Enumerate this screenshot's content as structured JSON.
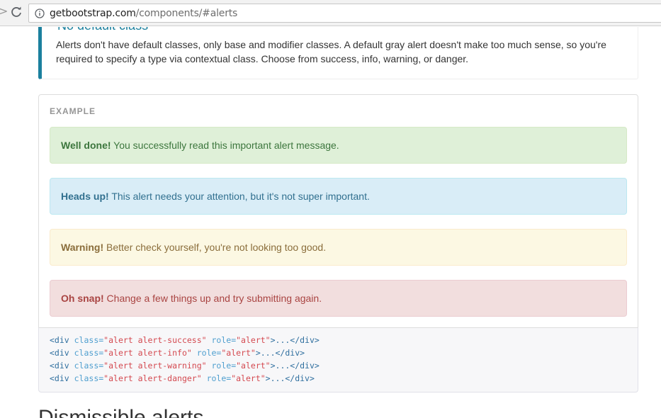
{
  "browser": {
    "url_host": "getbootstrap.com",
    "url_path": "/components/#alerts",
    "forward_glyph": ">"
  },
  "callout": {
    "title": "No default class",
    "body": "Alerts don't have default classes, only base and modifier classes. A default gray alert doesn't make too much sense, so you're required to specify a type via contextual class. Choose from success, info, warning, or danger."
  },
  "example": {
    "label": "EXAMPLE",
    "alerts": [
      {
        "strong": "Well done!",
        "text": " You successfully read this important alert message."
      },
      {
        "strong": "Heads up!",
        "text": " This alert needs your attention, but it's not super important."
      },
      {
        "strong": "Warning!",
        "text": " Better check yourself, you're not looking too good."
      },
      {
        "strong": "Oh snap!",
        "text": " Change a few things up and try submitting again."
      }
    ]
  },
  "code": {
    "lines": [
      {
        "open": "<div ",
        "class_attr": "class=",
        "class_val": "\"alert alert-success\"",
        "role_attr": " role=",
        "role_val": "\"alert\"",
        "close": ">...</div>"
      },
      {
        "open": "<div ",
        "class_attr": "class=",
        "class_val": "\"alert alert-info\"",
        "role_attr": " role=",
        "role_val": "\"alert\"",
        "close": ">...</div>"
      },
      {
        "open": "<div ",
        "class_attr": "class=",
        "class_val": "\"alert alert-warning\"",
        "role_attr": " role=",
        "role_val": "\"alert\"",
        "close": ">...</div>"
      },
      {
        "open": "<div ",
        "class_attr": "class=",
        "class_val": "\"alert alert-danger\"",
        "role_attr": " role=",
        "role_val": "\"alert\"",
        "close": ">...</div>"
      }
    ]
  },
  "next_section": {
    "title": "Dismissible alerts"
  },
  "colors": {
    "callout_accent": "#1b809e",
    "success_bg": "#dff0d8",
    "info_bg": "#d9edf7",
    "warning_bg": "#fcf8e3",
    "danger_bg": "#f2dede"
  }
}
